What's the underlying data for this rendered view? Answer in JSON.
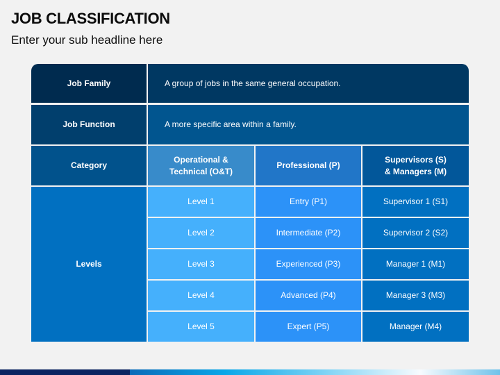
{
  "header": {
    "title": "JOB CLASSIFICATION",
    "subtitle": "Enter your sub headline here"
  },
  "table": {
    "job_family": {
      "label": "Job Family",
      "description": "A group of jobs in the same general occupation."
    },
    "job_function": {
      "label": "Job Function",
      "description": "A more specific area within a family."
    },
    "category": {
      "label": "Category",
      "columns": [
        {
          "line1": "Operational &",
          "line2": "Technical (O&T)"
        },
        {
          "line1": "Professional (P)",
          "line2": ""
        },
        {
          "line1": "Supervisors (S)",
          "line2": "& Managers (M)"
        }
      ]
    },
    "levels": {
      "label": "Levels",
      "rows": [
        [
          "Level 1",
          "Entry (P1)",
          "Supervisor 1 (S1)"
        ],
        [
          "Level 2",
          "Intermediate (P2)",
          "Supervisor 2 (S2)"
        ],
        [
          "Level 3",
          "Experienced (P3)",
          "Manager 1 (M1)"
        ],
        [
          "Level 4",
          "Advanced (P4)",
          "Manager 3 (M3)"
        ],
        [
          "Level 5",
          "Expert (P5)",
          "Manager (M4)"
        ]
      ]
    }
  },
  "colors": {
    "job_family_label": "#002b4f",
    "job_family_desc": "#003862",
    "job_function_label": "#013f6d",
    "job_function_desc": "#01558f",
    "category_label": "#01528c",
    "category_col1": "#388bca",
    "category_col2": "#2176c8",
    "category_col3": "#02579a",
    "levels_label": "#0170c1",
    "levels_col1": "#45b0fc",
    "levels_col2": "#2c92f8",
    "levels_col3": "#0170c1",
    "background": "#f2f2f2"
  }
}
